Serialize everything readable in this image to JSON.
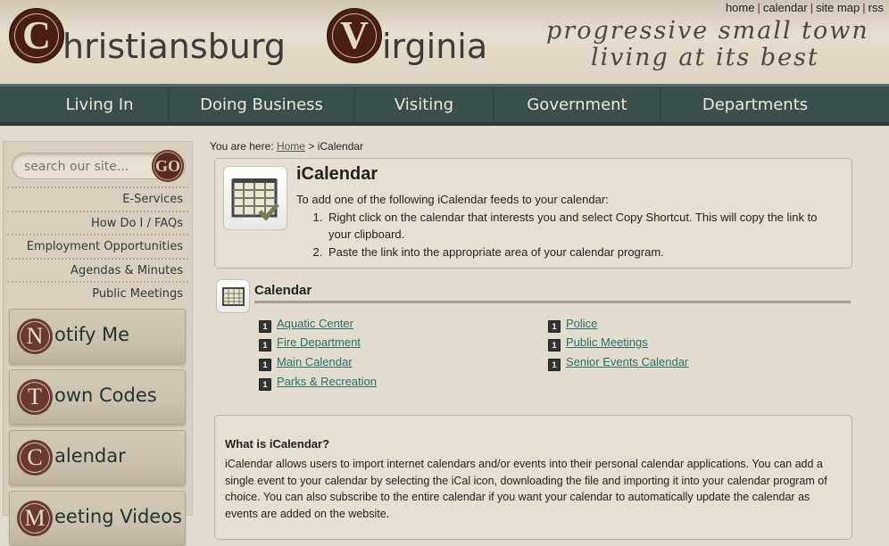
{
  "header": {
    "logo": {
      "seal1": "C",
      "word1": "hristiansburg",
      "seal2": "V",
      "word2": "irginia"
    },
    "tagline": [
      "progressive small town",
      "living at its best"
    ],
    "top_links": [
      "home",
      "calendar",
      "site map",
      "rss"
    ]
  },
  "nav": [
    "Living In",
    "Doing Business",
    "Visiting",
    "Government",
    "Departments"
  ],
  "sidebar": {
    "search_placeholder": "search our site...",
    "go_label": "GO",
    "quick_links": [
      "E-Services",
      "How Do I / FAQs",
      "Employment Opportunities",
      "Agendas & Minutes",
      "Public Meetings"
    ],
    "big_buttons": [
      {
        "initial": "N",
        "label": "otify Me"
      },
      {
        "initial": "T",
        "label": "own Codes"
      },
      {
        "initial": "C",
        "label": "alendar"
      },
      {
        "initial": "M",
        "label": "eeting Videos"
      }
    ]
  },
  "breadcrumb": {
    "prefix": "You are here:",
    "home": "Home",
    "sep": ">",
    "current": "iCalendar"
  },
  "intro": {
    "title": "iCalendar",
    "text": "To add one of the following iCalendar feeds to your calendar:",
    "steps": [
      "Right click on the calendar that interests you and select Copy Shortcut. This will copy the link to your clipboard.",
      "Paste the link into the appropriate area of your calendar program."
    ]
  },
  "calendar_section": {
    "title": "Calendar",
    "feeds_left": [
      "Aquatic Center",
      "Fire Department",
      "Main Calendar",
      "Parks & Recreation"
    ],
    "feeds_right": [
      "Police",
      "Public Meetings",
      "Senior Events Calendar"
    ]
  },
  "what": {
    "title": "What is iCalendar?",
    "text": "iCalendar allows users to import internet calendars and/or events into their personal calendar applications. You can add a single event to your calendar by selecting the iCal icon, downloading the file and importing it into your calendar program of choice. You can also subscribe to the entire calendar if you want your calendar to automatically update the calendar as events are added on the website."
  },
  "colors": {
    "nav_bg": "#3a4e4d",
    "link": "#2a6e6c",
    "seal": "#4a1d15"
  }
}
